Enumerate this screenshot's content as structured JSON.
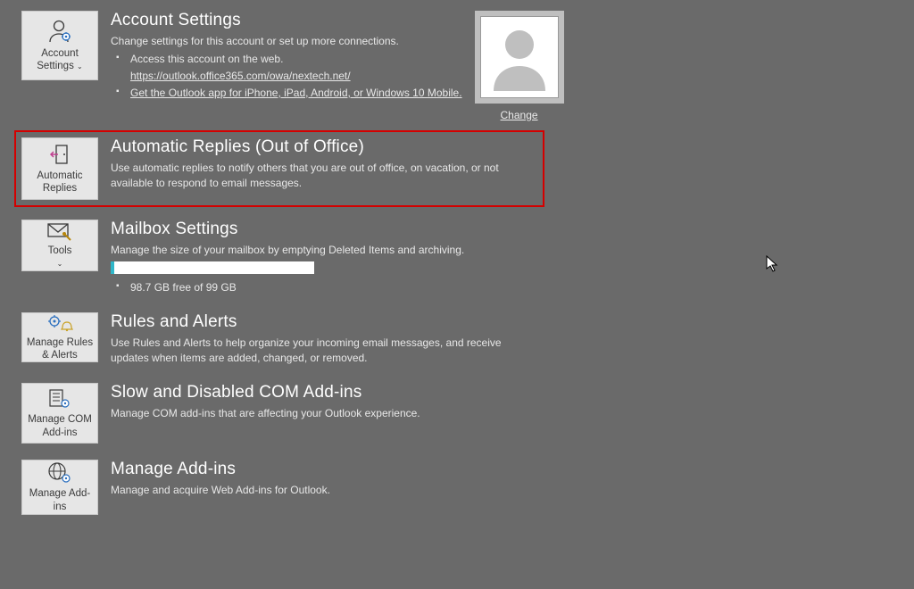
{
  "account": {
    "tile_l1": "Account",
    "tile_l2": "Settings",
    "title": "Account Settings",
    "desc": "Change settings for this account or set up more connections.",
    "bullet1": "Access this account on the web.",
    "url": "https://outlook.office365.com/owa/nextech.net/",
    "bullet2": "Get the Outlook app for iPhone, iPad, Android, or Windows 10 Mobile.",
    "change": "Change"
  },
  "auto": {
    "tile_l1": "Automatic",
    "tile_l2": "Replies",
    "title": "Automatic Replies (Out of Office)",
    "desc": "Use automatic replies to notify others that you are out of office, on vacation, or not available to respond to email messages."
  },
  "mailbox": {
    "tile_l1": "Tools",
    "title": "Mailbox Settings",
    "desc": "Manage the size of your mailbox by emptying Deleted Items and archiving.",
    "quota": "98.7 GB free of 99 GB"
  },
  "rules": {
    "tile_l1": "Manage Rules",
    "tile_l2": "& Alerts",
    "title": "Rules and Alerts",
    "desc": "Use Rules and Alerts to help organize your incoming email messages, and receive updates when items are added, changed, or removed."
  },
  "com": {
    "tile_l1": "Manage COM",
    "tile_l2": "Add-ins",
    "title": "Slow and Disabled COM Add-ins",
    "desc": "Manage COM add-ins that are affecting your Outlook experience."
  },
  "addins": {
    "tile_l1": "Manage Add-",
    "tile_l2": "ins",
    "title": "Manage Add-ins",
    "desc": "Manage and acquire Web Add-ins for Outlook."
  }
}
